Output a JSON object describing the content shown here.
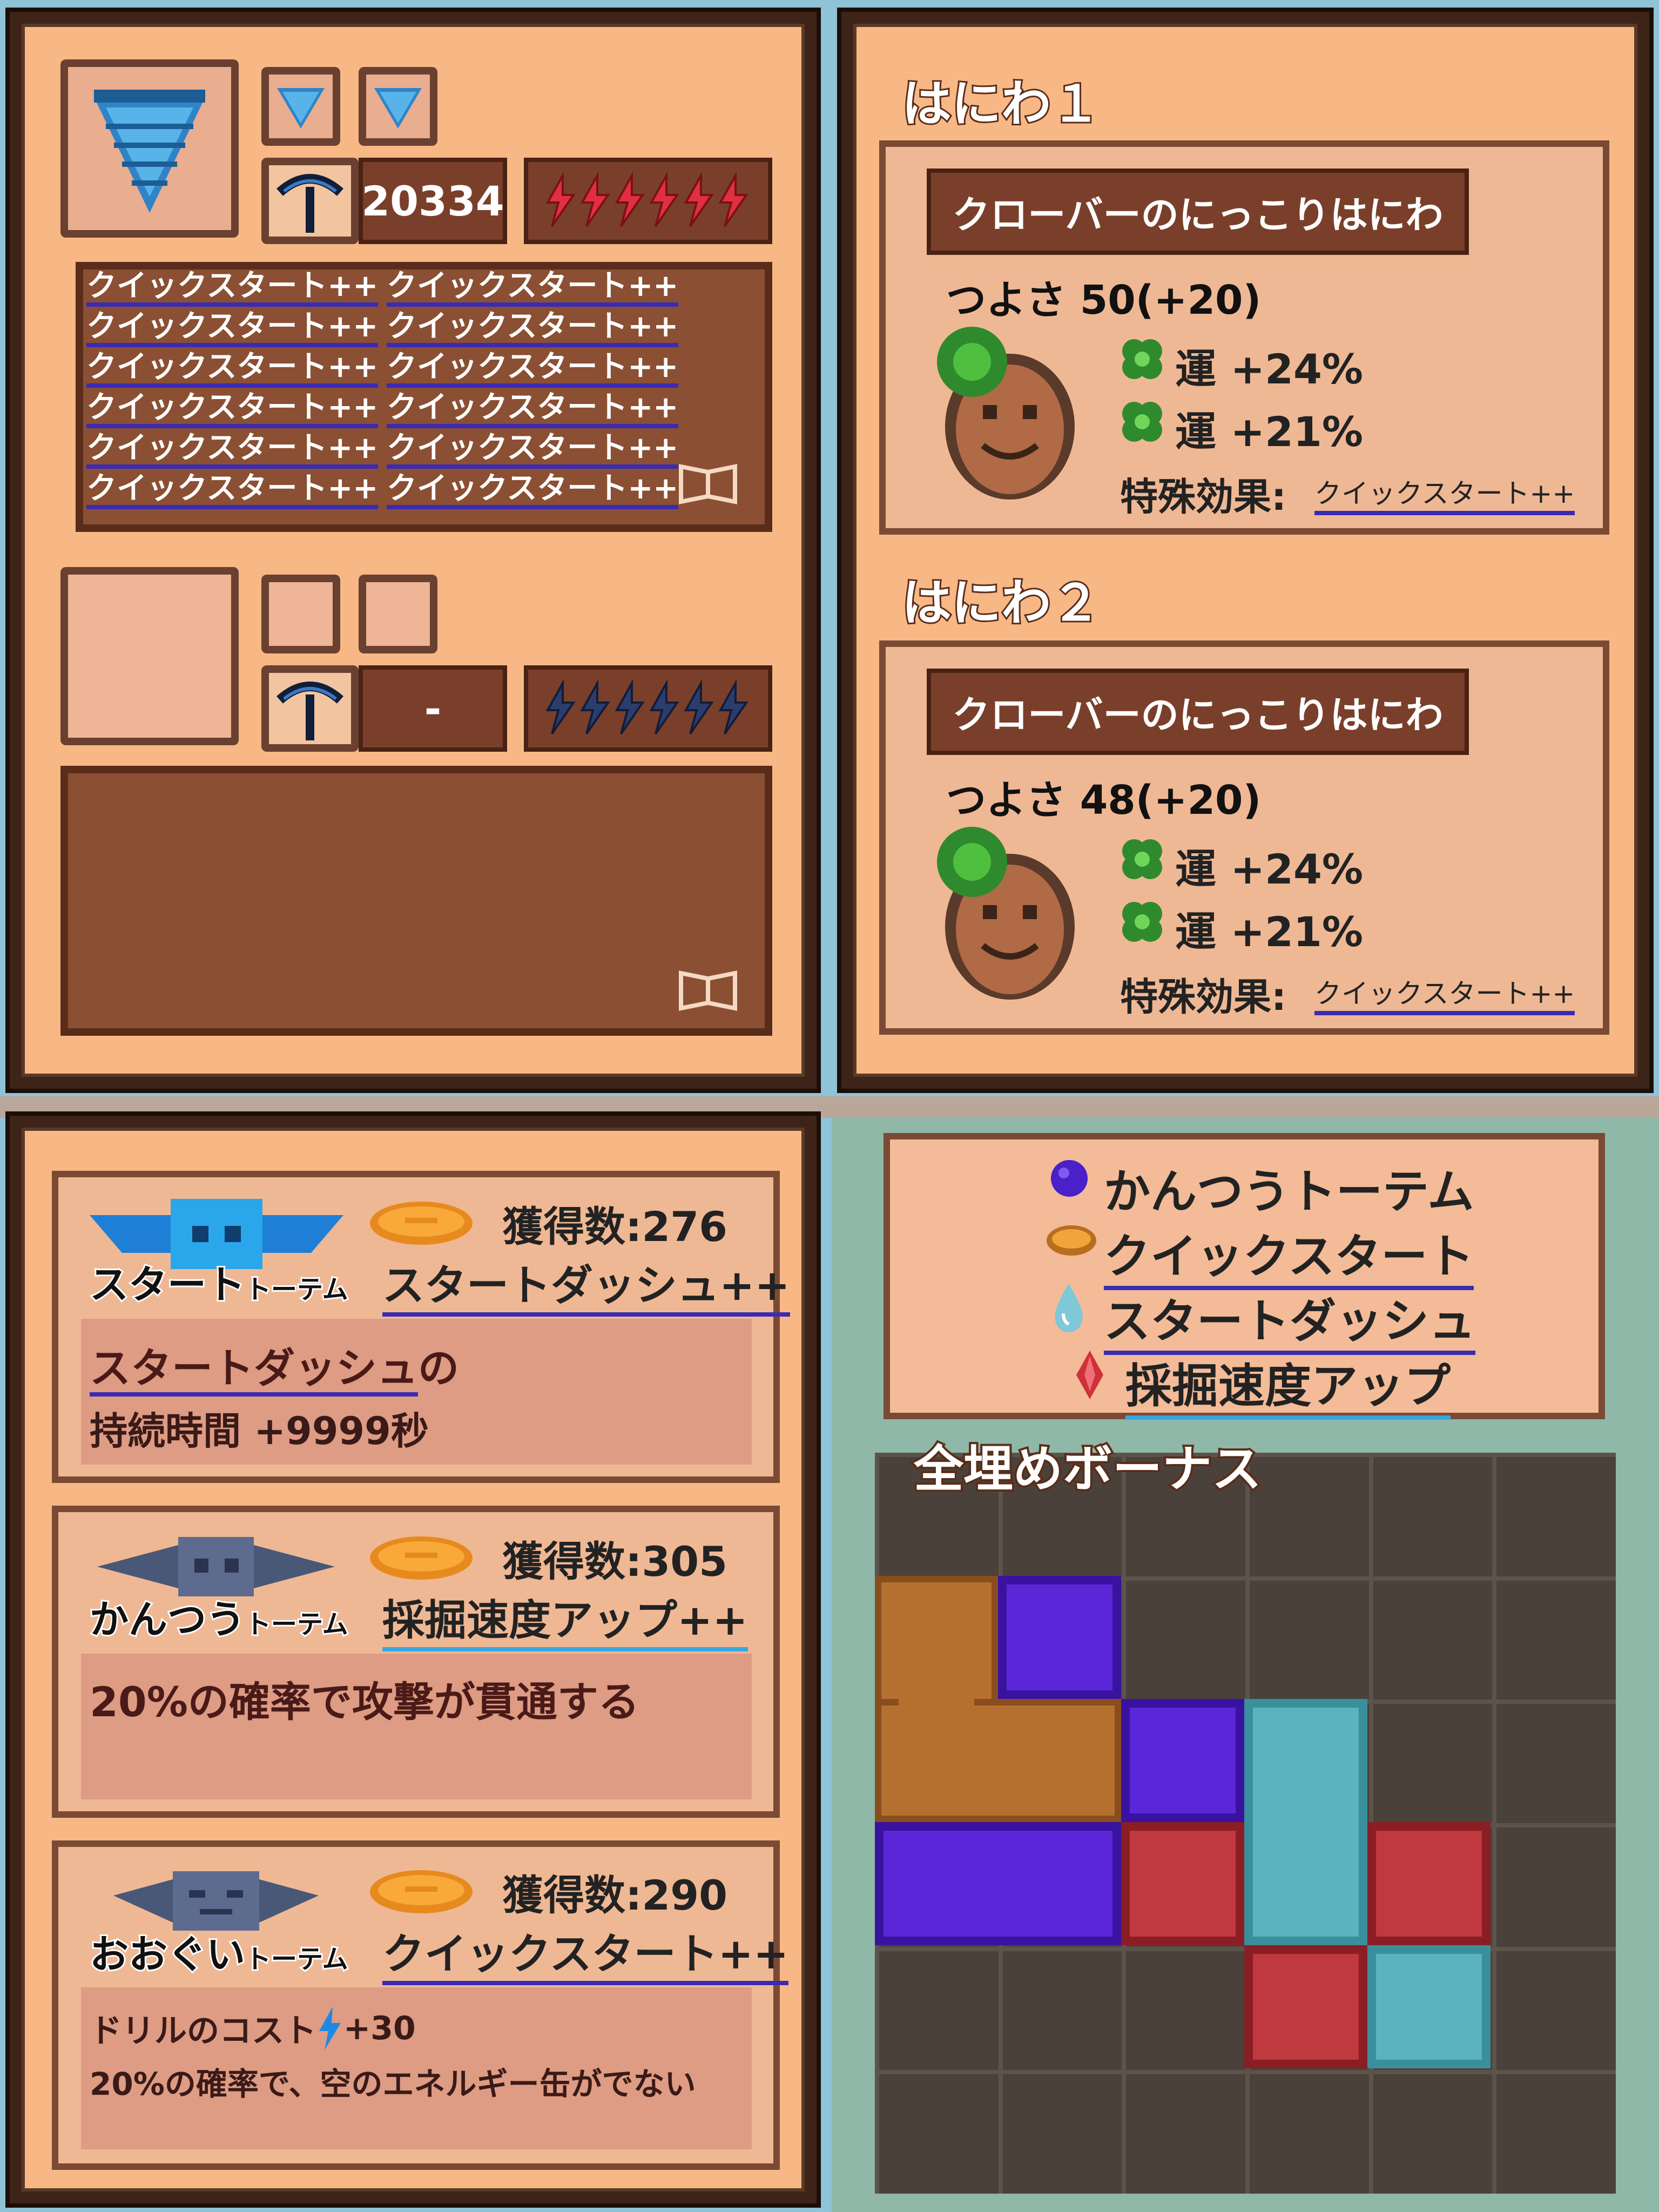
{
  "equip": {
    "slot1": {
      "count": "20334"
    },
    "slot2": {
      "count": "-"
    },
    "skills": [
      "クイックスタート++",
      "クイックスタート++",
      "クイックスタート++",
      "クイックスタート++",
      "クイックスタート++",
      "クイックスタート++",
      "クイックスタート++",
      "クイックスタート++",
      "クイックスタート++",
      "クイックスタート++",
      "クイックスタート++",
      "クイックスタート++"
    ]
  },
  "haniwa": [
    {
      "title": "はにわ１",
      "name": "クローバーのにっこりはにわ",
      "strength": "つよさ 50(+20)",
      "stats": [
        "運 +24%",
        "運 +21%"
      ],
      "special_label": "特殊効果:",
      "special_value": "クイックスタート++"
    },
    {
      "title": "はにわ２",
      "name": "クローバーのにっこりはにわ",
      "strength": "つよさ 48(+20)",
      "stats": [
        "運 +24%",
        "運 +21%"
      ],
      "special_label": "特殊効果:",
      "special_value": "クイックスタート++"
    }
  ],
  "totems": [
    {
      "name_main": "スタート",
      "name_sub": "トーテム",
      "count": "獲得数:276",
      "skill": "スタートダッシュ++",
      "desc_line1": "スタートダッシュ",
      "desc_line1_suffix": "の",
      "desc_line2": "持続時間 +9999秒"
    },
    {
      "name_main": "かんつう",
      "name_sub": "トーテム",
      "count": "獲得数:305",
      "skill": "採掘速度アップ++",
      "desc_line1": "20%の確率で攻撃が貫通する"
    },
    {
      "name_main": "おおぐい",
      "name_sub": "トーテム",
      "count": "獲得数:290",
      "skill": "クイックスタート++",
      "desc_line1_prefix": "ドリルのコスト",
      "desc_line1_suffix": "+30",
      "desc_line2": "20%の確率で、空のエネルギー缶がでない"
    }
  ],
  "legend": [
    {
      "label": "かんつうトーテム",
      "icon": "purple-orb-icon"
    },
    {
      "label": "クイックスタート",
      "icon": "bread-icon"
    },
    {
      "label": "スタートダッシュ",
      "icon": "water-drop-icon"
    },
    {
      "label": "採掘速度アップ",
      "icon": "red-gem-icon"
    }
  ],
  "bonus": {
    "title": "全埋めボーナス"
  },
  "colors": {
    "panel_bg": "#f7b886",
    "brown_box": "#8b4f33",
    "blue_underline": "#3b2bb3",
    "cyan_underline": "#35a8e0",
    "grid_bg": "#4a423a",
    "piece_orange": "#b5702f",
    "piece_purple": "#5b26d8",
    "piece_red": "#c0393e",
    "piece_cyan": "#5bb3c0"
  }
}
